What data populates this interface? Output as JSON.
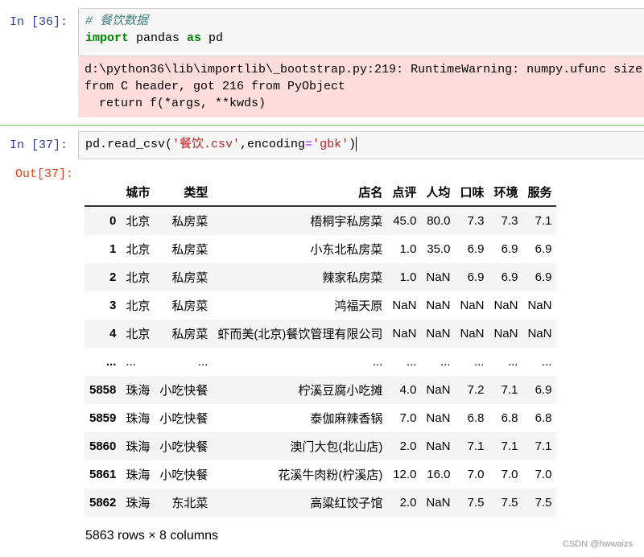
{
  "cells": [
    {
      "prompt": "In  [36]:",
      "comment": "# 餐饮数据",
      "code": {
        "kw1": "import",
        "mid": " pandas ",
        "kw2": "as",
        "end": " pd"
      },
      "stderr": "d:\\python36\\lib\\importlib\\_bootstrap.py:219: RuntimeWarning: numpy.ufunc size\nfrom C header, got 216 from PyObject\n  return f(*args, **kwds)"
    },
    {
      "prompt": "In  [37]:",
      "code": {
        "a": "pd.read_csv(",
        "s1": "'餐饮.csv'",
        "b": ",encoding",
        "eq": "=",
        "s2": "'gbk'",
        "c": ")"
      },
      "out_prompt": "Out[37]:"
    }
  ],
  "table": {
    "columns": [
      "",
      "城市",
      "类型",
      "店名",
      "点评",
      "人均",
      "口味",
      "环境",
      "服务"
    ],
    "rows": [
      [
        "0",
        "北京",
        "私房菜",
        "梧桐宇私房菜",
        "45.0",
        "80.0",
        "7.3",
        "7.3",
        "7.1"
      ],
      [
        "1",
        "北京",
        "私房菜",
        "小东北私房菜",
        "1.0",
        "35.0",
        "6.9",
        "6.9",
        "6.9"
      ],
      [
        "2",
        "北京",
        "私房菜",
        "辣家私房菜",
        "1.0",
        "NaN",
        "6.9",
        "6.9",
        "6.9"
      ],
      [
        "3",
        "北京",
        "私房菜",
        "鸿福天原",
        "NaN",
        "NaN",
        "NaN",
        "NaN",
        "NaN"
      ],
      [
        "4",
        "北京",
        "私房菜",
        "虾而美(北京)餐饮管理有限公司",
        "NaN",
        "NaN",
        "NaN",
        "NaN",
        "NaN"
      ],
      [
        "...",
        "...",
        "...",
        "...",
        "...",
        "...",
        "...",
        "...",
        "..."
      ],
      [
        "5858",
        "珠海",
        "小吃快餐",
        "柠溪豆腐小吃摊",
        "4.0",
        "NaN",
        "7.2",
        "7.1",
        "6.9"
      ],
      [
        "5859",
        "珠海",
        "小吃快餐",
        "泰伽麻辣香锅",
        "7.0",
        "NaN",
        "6.8",
        "6.8",
        "6.8"
      ],
      [
        "5860",
        "珠海",
        "小吃快餐",
        "澳门大包(北山店)",
        "2.0",
        "NaN",
        "7.1",
        "7.1",
        "7.1"
      ],
      [
        "5861",
        "珠海",
        "小吃快餐",
        "花溪牛肉粉(柠溪店)",
        "12.0",
        "16.0",
        "7.0",
        "7.0",
        "7.0"
      ],
      [
        "5862",
        "珠海",
        "东北菜",
        "高粱红饺子馆",
        "2.0",
        "NaN",
        "7.5",
        "7.5",
        "7.5"
      ]
    ],
    "shape": "5863 rows × 8 columns"
  },
  "watermark": "CSDN @hwwaizs"
}
